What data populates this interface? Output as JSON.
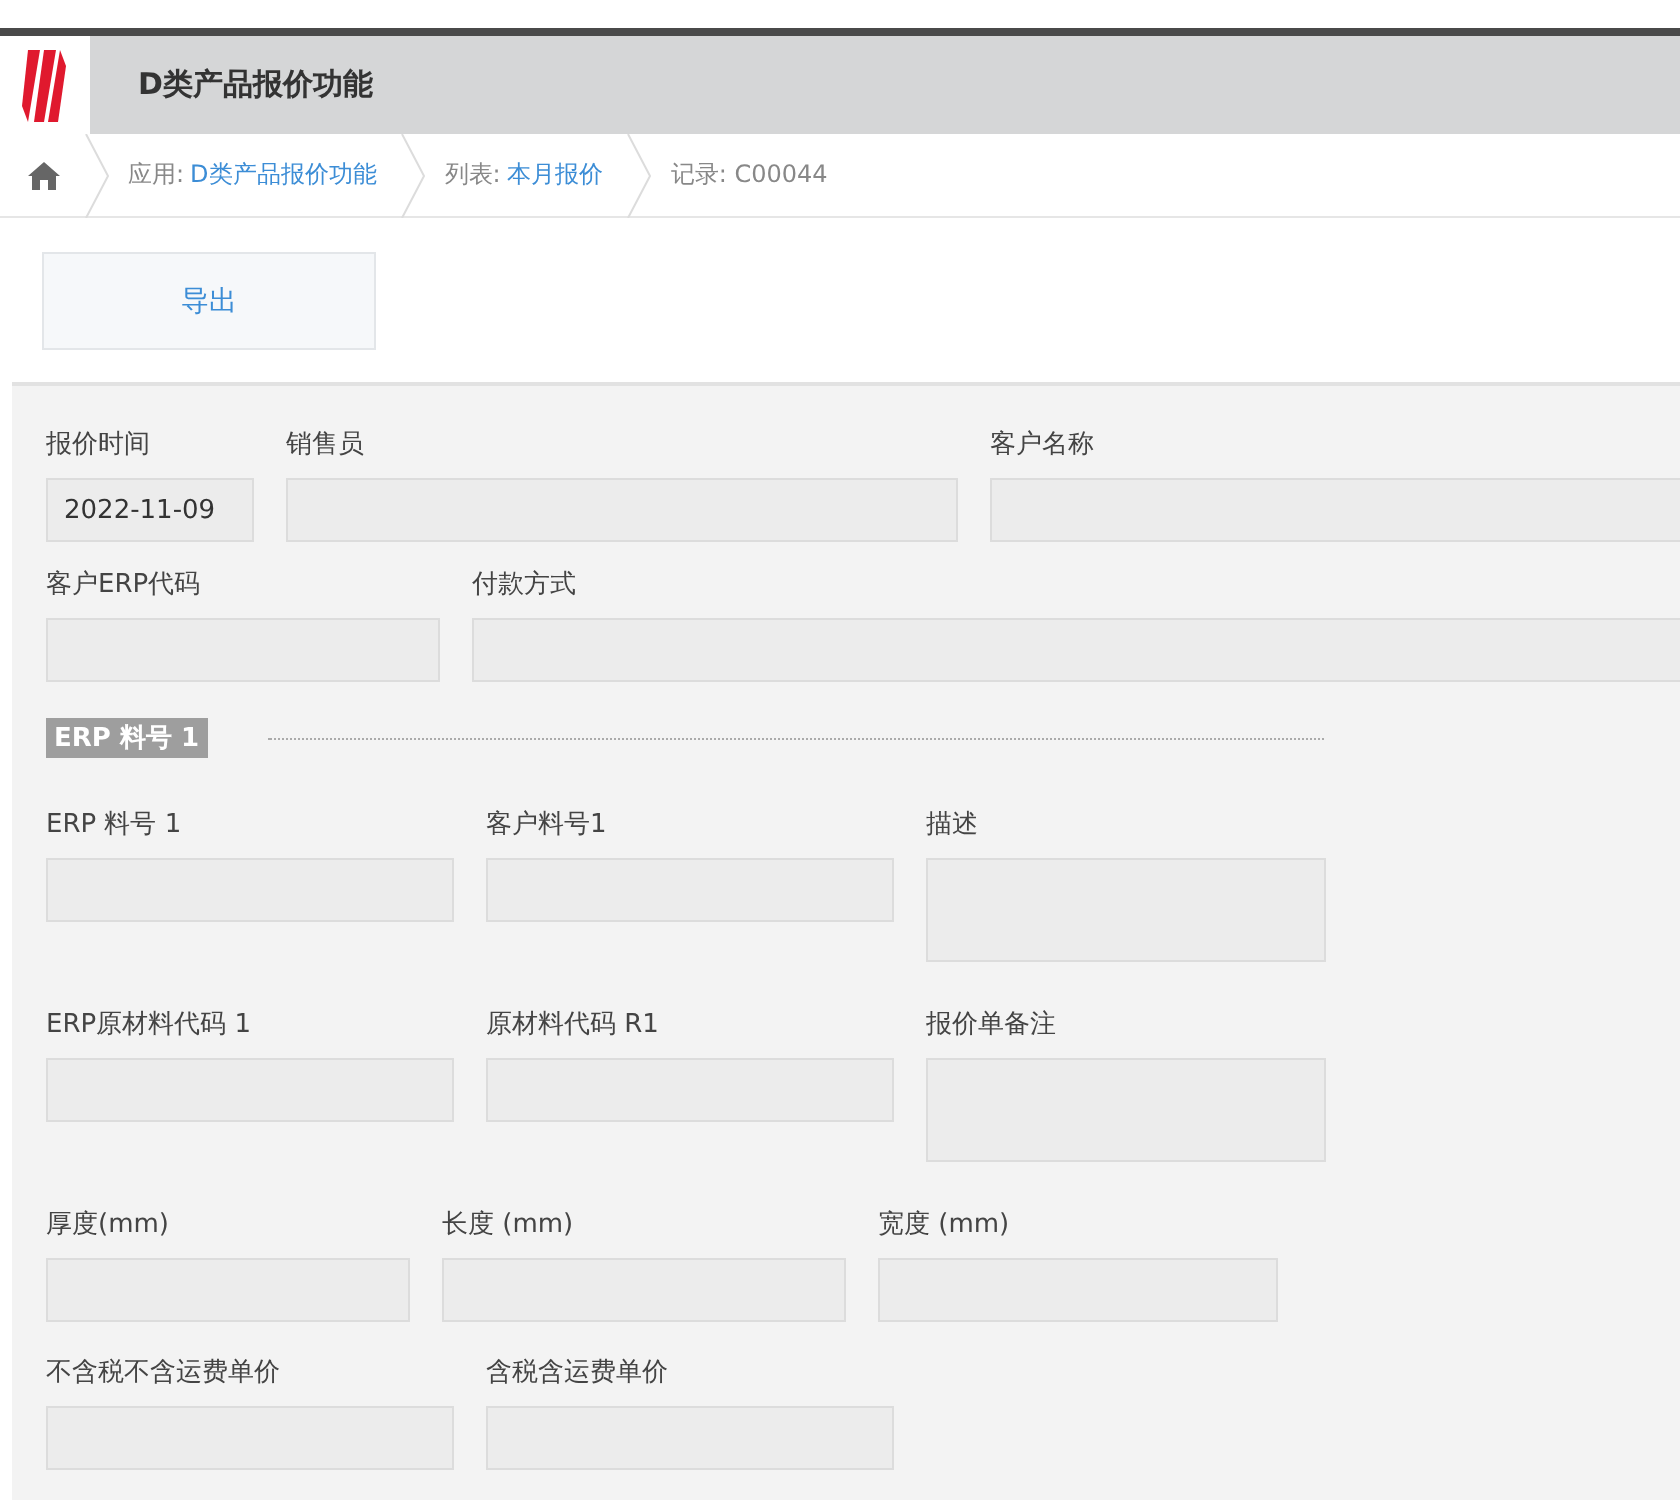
{
  "header": {
    "title": "D类产品报价功能"
  },
  "breadcrumb": [
    {
      "label": "应用:",
      "link": "D类产品报价功能"
    },
    {
      "label": "列表:",
      "link": "本月报价"
    },
    {
      "label": "记录: C00044"
    }
  ],
  "toolbar": {
    "buttons": [
      "导出"
    ]
  },
  "form": {
    "rows": [
      {
        "fields": [
          {
            "label": "报价时间",
            "kind": "text",
            "value": "2022-11-09"
          },
          {
            "label": "销售员",
            "kind": "text"
          },
          {
            "label": "客户名称",
            "kind": "text"
          }
        ]
      },
      {
        "fields": [
          {
            "label": "客户ERP代码",
            "kind": "text"
          },
          {
            "label": "付款方式",
            "kind": "text"
          }
        ]
      },
      {
        "section": "ERP 料号 1"
      },
      {
        "fields": [
          {
            "label": "ERP 料号 1",
            "kind": "text"
          },
          {
            "label": "客户料号1",
            "kind": "text"
          },
          {
            "label": "描述",
            "kind": "textarea"
          }
        ]
      },
      {
        "fields": [
          {
            "label": "ERP原材料代码 1",
            "kind": "text"
          },
          {
            "label": "原材料代码 R1",
            "kind": "text"
          },
          {
            "label": "报价单备注",
            "kind": "textarea"
          }
        ]
      },
      {
        "fields": [
          {
            "label": "厚度(mm)",
            "kind": "text"
          },
          {
            "label": "长度 (mm)",
            "kind": "text"
          },
          {
            "label": "宽度 (mm)",
            "kind": "text"
          }
        ]
      },
      {
        "fields": [
          {
            "label": "不含税不含运费单价",
            "kind": "text"
          },
          {
            "label": "含税含运费单价",
            "kind": "text"
          }
        ]
      }
    ]
  }
}
